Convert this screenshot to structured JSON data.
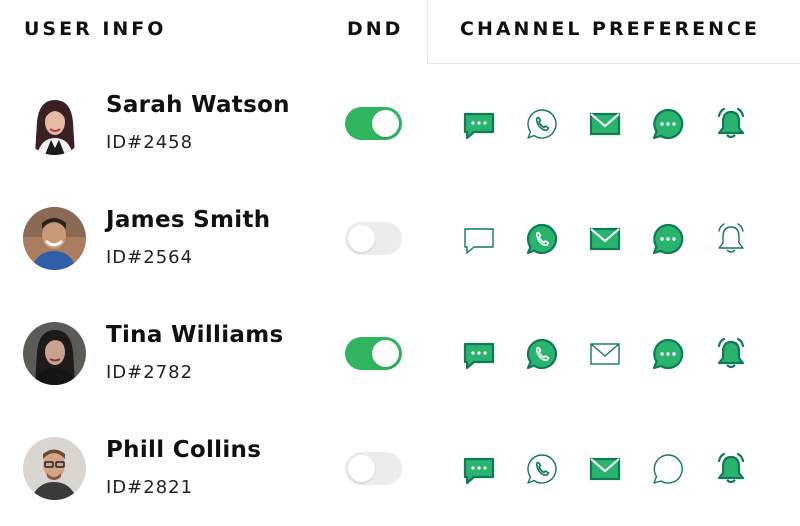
{
  "header": {
    "user_info": "USER INFO",
    "dnd": "DND",
    "channel_preference": "CHANNEL PREFERENCE"
  },
  "colors": {
    "accent": "#2fb45f",
    "icon_dark": "#0f7a57",
    "icon_fill": "#29b46e",
    "toggle_off": "#ececec"
  },
  "channels": [
    "sms-icon",
    "whatsapp-icon",
    "email-icon",
    "chat-icon",
    "notification-bell-icon"
  ],
  "users": [
    {
      "name": "Sarah Watson",
      "id": "ID#2458",
      "dnd": true,
      "prefs": {
        "sms": true,
        "whatsapp": false,
        "email": true,
        "chat": true,
        "bell": true
      }
    },
    {
      "name": "James Smith",
      "id": "ID#2564",
      "dnd": false,
      "prefs": {
        "sms": false,
        "whatsapp": true,
        "email": true,
        "chat": true,
        "bell": false
      }
    },
    {
      "name": "Tina Williams",
      "id": "ID#2782",
      "dnd": true,
      "prefs": {
        "sms": true,
        "whatsapp": true,
        "email": false,
        "chat": true,
        "bell": true
      }
    },
    {
      "name": "Phill Collins",
      "id": "ID#2821",
      "dnd": false,
      "prefs": {
        "sms": true,
        "whatsapp": false,
        "email": true,
        "chat": false,
        "bell": true
      }
    }
  ]
}
